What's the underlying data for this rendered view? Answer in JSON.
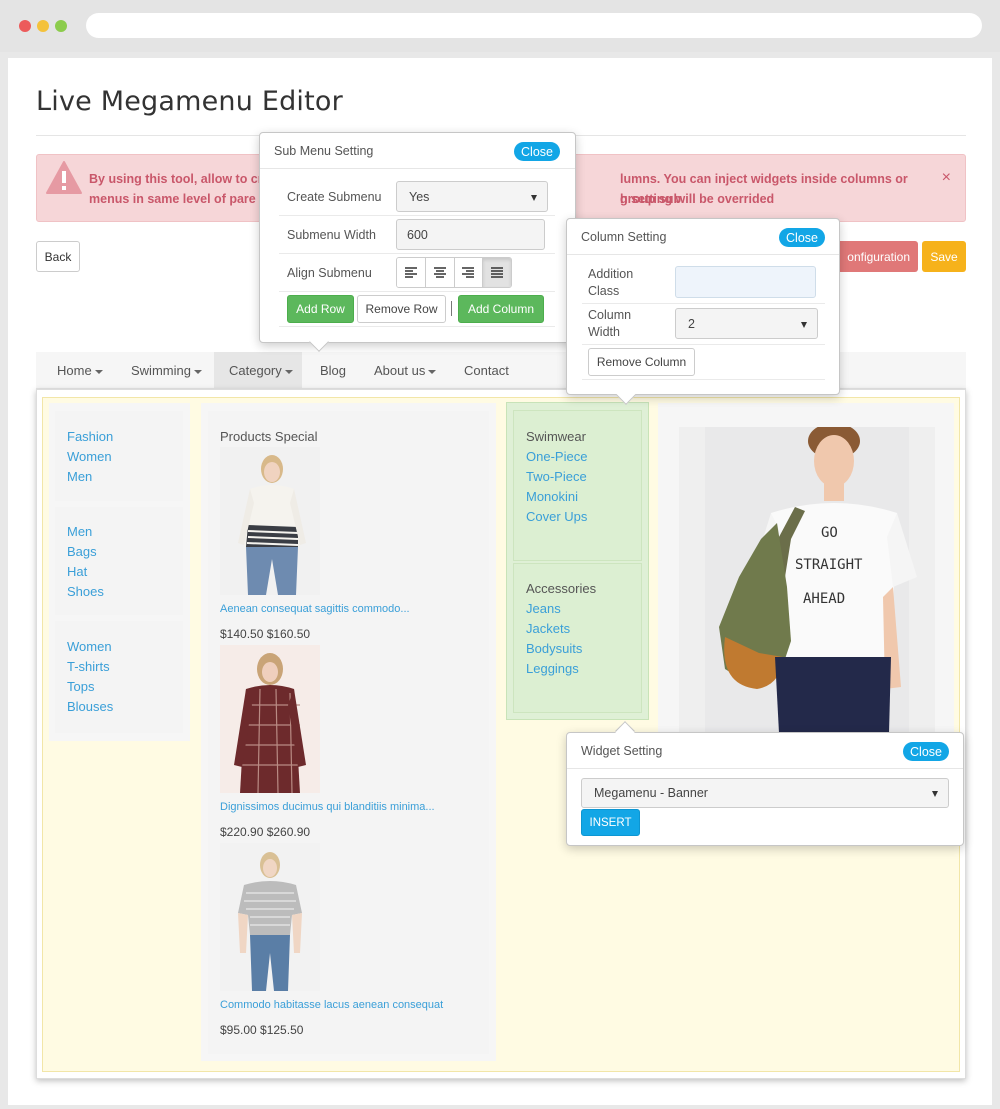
{
  "page": {
    "title": "Live Megamenu Editor"
  },
  "alert": {
    "text_left_1": "By using this tool, allow to cr",
    "text_right_1": "lumns. You can inject widgets inside columns or group sub",
    "text_left_2": "menus in same level of pare",
    "text_right_2": "h setting will be overrided",
    "close": "×",
    "color": "#c9576a"
  },
  "toolbar": {
    "back": "Back",
    "configuration": "onfiguration",
    "save": "Save"
  },
  "menu": {
    "items": [
      {
        "label": "Home",
        "caret": true
      },
      {
        "label": "Swimming",
        "caret": true
      },
      {
        "label": "Category",
        "caret": true
      },
      {
        "label": "Blog",
        "caret": false
      },
      {
        "label": "About us",
        "caret": true
      },
      {
        "label": "Contact",
        "caret": false
      }
    ]
  },
  "column1": {
    "group1": [
      "Fashion",
      "Women",
      "Men"
    ],
    "group2": [
      "Men",
      "Bags",
      "Hat",
      "Shoes"
    ],
    "group3": [
      "Women",
      "T-shirts",
      "Tops",
      "Blouses"
    ]
  },
  "column2": {
    "heading": "Products Special",
    "products": [
      {
        "name": "Aenean consequat sagittis commodo...",
        "price": "$140.50 $160.50"
      },
      {
        "name": "Dignissimos ducimus qui blanditiis minima...",
        "price": "$220.90 $260.90"
      },
      {
        "name": "Commodo habitasse lacus aenean consequat",
        "price": "$95.00 $125.50"
      }
    ]
  },
  "column3": {
    "group1": {
      "heading": "Swimwear",
      "links": [
        "One-Piece",
        "Two-Piece",
        "Monokini",
        "Cover Ups"
      ]
    },
    "group2": {
      "heading": "Accessories",
      "links": [
        "Jeans",
        "Jackets",
        "Bodysuits",
        "Leggings"
      ]
    }
  },
  "banner": {
    "shirt_text": [
      "GO",
      "STRAIGHT",
      "AHEAD"
    ]
  },
  "submenu_popup": {
    "title": "Sub Menu Setting",
    "close": "Close",
    "create_label": "Create Submenu",
    "create_value": "Yes",
    "width_label": "Submenu Width",
    "width_value": "600",
    "align_label": "Align Submenu",
    "add_row": "Add Row",
    "remove_row": "Remove Row",
    "add_column": "Add Column"
  },
  "column_popup": {
    "title": "Column Setting",
    "close": "Close",
    "class_label_1": "Addition",
    "class_label_2": "Class",
    "class_value": "",
    "width_label_1": "Column",
    "width_label_2": "Width",
    "width_value": "2",
    "remove": "Remove Column"
  },
  "widget_popup": {
    "title": "Widget Setting",
    "close": "Close",
    "select_value": "Megamenu - Banner",
    "insert": "INSERT"
  },
  "colors": {
    "link": "#3a9fd8",
    "accent_blue": "#12a6e6",
    "green_button": "#5cb85c",
    "save": "#f6b21b",
    "config": "#e07878"
  }
}
